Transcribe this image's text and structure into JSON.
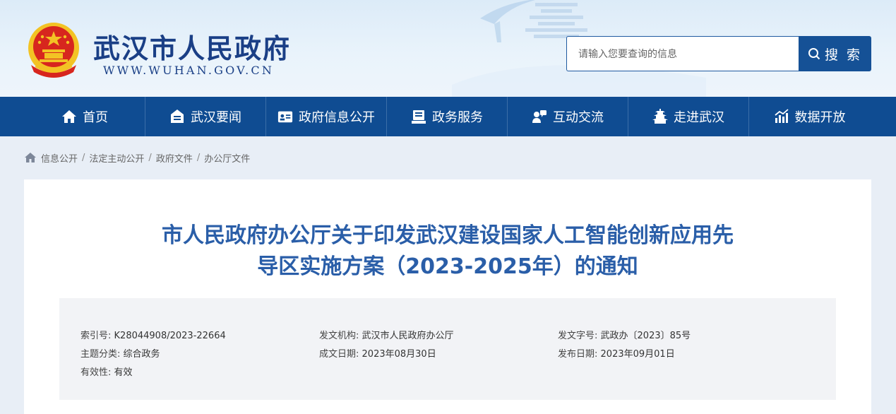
{
  "header": {
    "site_title": "武汉市人民政府",
    "site_url": "WWW.WUHAN.GOV.CN",
    "search_placeholder": "请输入您要查询的信息",
    "search_label": "搜 索"
  },
  "nav": {
    "items": [
      {
        "label": "首页",
        "icon": "home-icon"
      },
      {
        "label": "武汉要闻",
        "icon": "news-icon"
      },
      {
        "label": "政府信息公开",
        "icon": "id-card-icon"
      },
      {
        "label": "政务服务",
        "icon": "service-icon"
      },
      {
        "label": "互动交流",
        "icon": "chat-icon"
      },
      {
        "label": "走进武汉",
        "icon": "pagoda-icon"
      },
      {
        "label": "数据开放",
        "icon": "chart-icon"
      }
    ]
  },
  "breadcrumb": {
    "items": [
      "信息公开",
      "法定主动公开",
      "政府文件",
      "办公厅文件"
    ],
    "separator": "/"
  },
  "article": {
    "title_line1": "市人民政府办公厅关于印发武汉建设国家人工智能创新应用先",
    "title_line2": "导区实施方案（2023-2025年）的通知"
  },
  "meta": {
    "index_no": {
      "label": "索引号:",
      "value": "K28044908/2023-22664"
    },
    "issuer": {
      "label": "发文机构:",
      "value": "武汉市人民政府办公厅"
    },
    "doc_no": {
      "label": "发文字号:",
      "value": "武政办〔2023〕85号"
    },
    "category": {
      "label": "主题分类:",
      "value": "综合政务"
    },
    "created_date": {
      "label": "成文日期:",
      "value": "2023年08月30日"
    },
    "publish_date": {
      "label": "发布日期:",
      "value": "2023年09月01日"
    },
    "validity": {
      "label": "有效性:",
      "value": "有效"
    }
  },
  "colors": {
    "brand_blue": "#0f4c92",
    "title_blue": "#2a5ea8",
    "emblem_red": "#d7261e",
    "emblem_gold": "#f3c324"
  }
}
